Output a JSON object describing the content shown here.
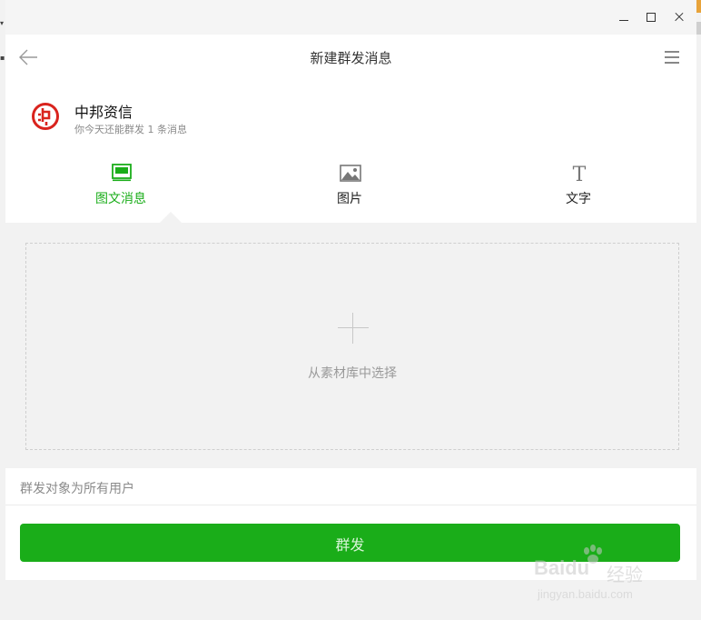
{
  "window": {
    "controls": [
      "minimize",
      "maximize",
      "close"
    ]
  },
  "header": {
    "title": "新建群发消息",
    "back_icon": "arrow-left-icon",
    "menu_icon": "hamburger-menu-icon"
  },
  "account": {
    "name": "中邦资信",
    "quota_text": "你今天还能群发 1 条消息",
    "brand_color": "#d9231d"
  },
  "tabs": [
    {
      "label": "图文消息",
      "icon": "news-card-icon",
      "active": true
    },
    {
      "label": "图片",
      "icon": "image-icon",
      "active": false
    },
    {
      "label": "文字",
      "icon": "text-T-icon",
      "active": false
    }
  ],
  "content": {
    "select_label": "从素材库中选择",
    "icon": "plus-icon"
  },
  "target": {
    "text": "群发对象为所有用户"
  },
  "send": {
    "label": "群发"
  },
  "watermark": {
    "brand": "Baidu",
    "cn": "经验",
    "url": "jingyan.baidu.com"
  },
  "colors": {
    "accent": "#1aad19",
    "background": "#f2f2f2",
    "panel": "#ffffff"
  }
}
